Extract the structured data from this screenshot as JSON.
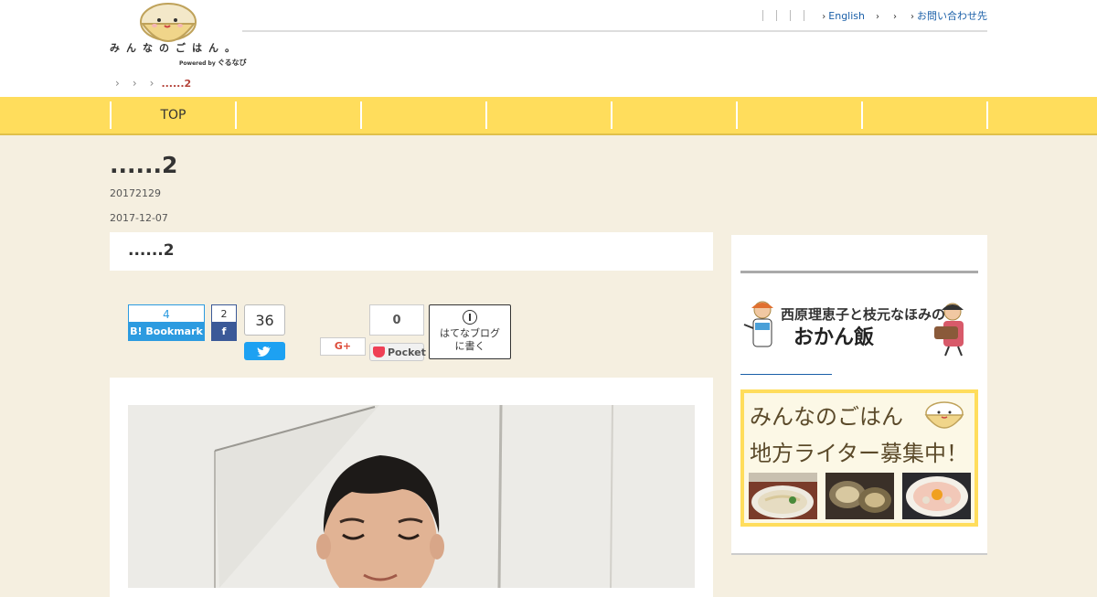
{
  "header": {
    "logo_text": "みんなのごはん。",
    "logo_powered": "Powered by",
    "logo_brand": "ぐるなび",
    "util_nav": [
      {
        "label": "English"
      },
      {
        "label": ""
      },
      {
        "label": ""
      },
      {
        "label": "お問い合わせ先"
      }
    ]
  },
  "breadcrumb": {
    "current": "......2"
  },
  "gnav": {
    "items": [
      {
        "label": "TOP"
      },
      {
        "label": ""
      },
      {
        "label": ""
      },
      {
        "label": ""
      },
      {
        "label": ""
      },
      {
        "label": ""
      },
      {
        "label": ""
      }
    ]
  },
  "article": {
    "title": "......2",
    "meta_line": "20172129",
    "date": "2017-12-07",
    "section_heading": "......2"
  },
  "social": {
    "hatebu_count": "4",
    "hatebu_label": "Bookmark",
    "facebook_count": "2",
    "twitter_count": "36",
    "googleplus_label": "G+",
    "pocket_count": "0",
    "pocket_label": "Pocket",
    "hatena_blog_label_1": "はてなブログ",
    "hatena_blog_label_2": "に書く"
  },
  "sidebar": {
    "okan_banner_title": "西原理恵子と枝元なほみの",
    "okan_banner_sub": "おかん飯",
    "writer_banner_line1": "みんなのごはん",
    "writer_banner_line2": "地方ライター募集中！"
  },
  "colors": {
    "nav_yellow": "#ffdd5c",
    "page_bg": "#f5efe0",
    "hatebu_blue": "#2c9be0",
    "facebook_blue": "#3b5998",
    "twitter_blue": "#1da1f2",
    "pocket_red": "#ef4056",
    "breadcrumb_current": "#b5453c"
  }
}
